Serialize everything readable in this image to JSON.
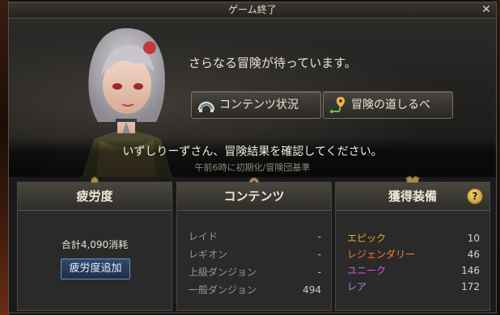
{
  "window": {
    "title": "ゲーム終了"
  },
  "hero": {
    "tagline": "さらなる冒険が待っています。",
    "buttons": {
      "content_status": "コンテンツ状況",
      "adventure_road": "冒険の道しるべ"
    },
    "result_message": "いずしりーずさん、冒険結果を確認してください。",
    "reset_note": "午前6時に初期化/冒険団基準"
  },
  "panels": {
    "fatigue": {
      "title": "疲労度",
      "total": "合計4,090消耗",
      "add_button": "疲労度追加"
    },
    "content": {
      "title": "コンテンツ",
      "rows": [
        {
          "label": "レイド",
          "value": "-"
        },
        {
          "label": "レギオン",
          "value": "-"
        },
        {
          "label": "上級ダンジョン",
          "value": "-"
        },
        {
          "label": "一般ダンジョン",
          "value": "494"
        }
      ]
    },
    "gear": {
      "title": "獲得装備",
      "help": "?",
      "rows": [
        {
          "label": "エピック",
          "value": "10",
          "color": "#f0a531"
        },
        {
          "label": "レジェンダリー",
          "value": "46",
          "color": "#ff7a2a"
        },
        {
          "label": "ユニーク",
          "value": "146",
          "color": "#e04ff0"
        },
        {
          "label": "レア",
          "value": "172",
          "color": "#b47ef0"
        }
      ]
    }
  }
}
